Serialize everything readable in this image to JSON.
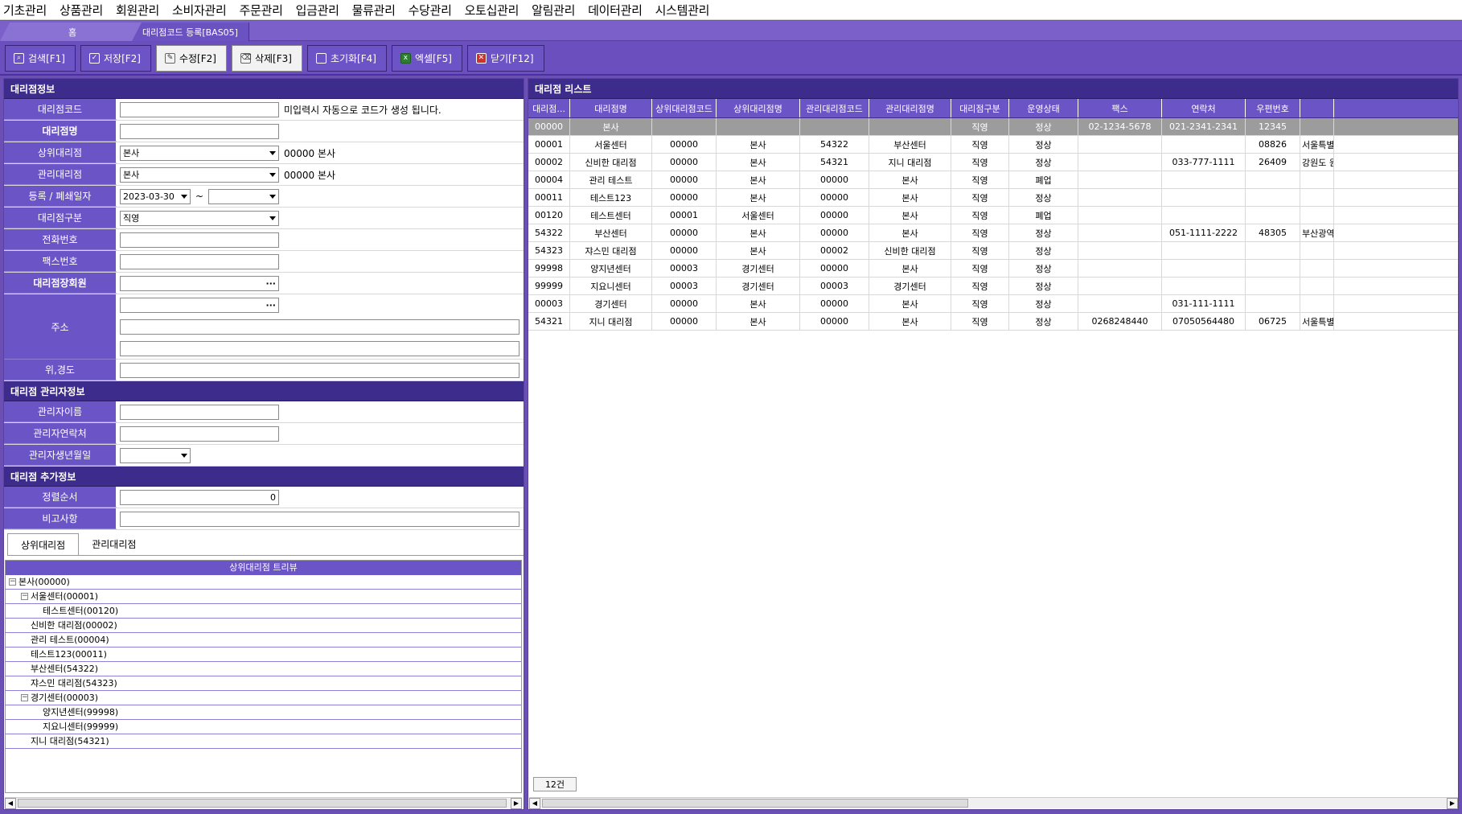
{
  "menu": [
    "기초관리",
    "상품관리",
    "회원관리",
    "소비자관리",
    "주문관리",
    "입금관리",
    "물류관리",
    "수당관리",
    "오토십관리",
    "알림관리",
    "데이터관리",
    "시스템관리"
  ],
  "tabs": {
    "home": "홈",
    "current": "대리점코드 등록[BAS05]"
  },
  "toolbar": {
    "search": "검색[F1]",
    "save": "저장[F2]",
    "edit": "수정[F2]",
    "delete": "삭제[F3]",
    "reset": "초기화[F4]",
    "excel": "엑셀[F5]",
    "close": "닫기[F12]"
  },
  "left": {
    "section_info": "대리점정보",
    "code_label": "대리점코드",
    "code_hint": "미입력시 자동으로 코드가 생성 됩니다.",
    "name_label": "대리점명",
    "parent_label": "상위대리점",
    "parent_select": "본사",
    "parent_text": "00000 본사",
    "manage_label": "관리대리점",
    "manage_select": "본사",
    "manage_text": "00000 본사",
    "date_label": "등록 / 폐쇄일자",
    "date_from": "2023-03-30",
    "date_sep": "~",
    "type_label": "대리점구분",
    "type_select": "직영",
    "phone_label": "전화번호",
    "fax_label": "팩스번호",
    "owner_label": "대리점장회원",
    "owner_dots": "···",
    "address_label": "주소",
    "address_dots": "···",
    "latlng_label": "위,경도",
    "section_manager": "대리점 관리자정보",
    "mgr_name_label": "관리자이름",
    "mgr_phone_label": "관리자연락처",
    "mgr_birth_label": "관리자생년월일",
    "section_extra": "대리점 추가정보",
    "order_label": "정렬순서",
    "order_value": "0",
    "note_label": "비고사항",
    "tree_tab_parent": "상위대리점",
    "tree_tab_manage": "관리대리점",
    "tree_title": "상위대리점 트리뷰",
    "tree": [
      {
        "label": "본사(00000)",
        "box": "⊟"
      },
      {
        "label": "서울센터(00001)",
        "box": "⊟"
      },
      {
        "label": "테스트센터(00120)",
        "box": ""
      },
      {
        "label": "신비한 대리점(00002)",
        "box": ""
      },
      {
        "label": "관리 테스트(00004)",
        "box": ""
      },
      {
        "label": "테스트123(00011)",
        "box": ""
      },
      {
        "label": "부산센터(54322)",
        "box": ""
      },
      {
        "label": "쟈스민 대리점(54323)",
        "box": ""
      },
      {
        "label": "경기센터(00003)",
        "box": "⊟"
      },
      {
        "label": "양지년센터(99998)",
        "box": ""
      },
      {
        "label": "지요니센터(99999)",
        "box": ""
      },
      {
        "label": "지니 대리점(54321)",
        "box": ""
      }
    ]
  },
  "right": {
    "title": "대리점 리스트",
    "columns": [
      "대리점...",
      "대리점명",
      "상위대리점코드",
      "상위대리점명",
      "관리대리점코드",
      "관리대리점명",
      "대리점구분",
      "운영상태",
      "팩스",
      "연락처",
      "우편번호",
      ""
    ],
    "rows": [
      [
        "00000",
        "본사",
        "",
        "",
        "",
        "",
        "직영",
        "정상",
        "02-1234-5678",
        "021-2341-2341",
        "12345",
        ""
      ],
      [
        "00001",
        "서울센터",
        "00000",
        "본사",
        "54322",
        "부산센터",
        "직영",
        "정상",
        "",
        "",
        "08826",
        "서울특별"
      ],
      [
        "00002",
        "신비한 대리점",
        "00000",
        "본사",
        "54321",
        "지니 대리점",
        "직영",
        "정상",
        "",
        "033-777-1111",
        "26409",
        "강원도 원"
      ],
      [
        "00004",
        "관리 테스트",
        "00000",
        "본사",
        "00000",
        "본사",
        "직영",
        "폐업",
        "",
        "",
        "",
        ""
      ],
      [
        "00011",
        "테스트123",
        "00000",
        "본사",
        "00000",
        "본사",
        "직영",
        "정상",
        "",
        "",
        "",
        ""
      ],
      [
        "00120",
        "테스트센터",
        "00001",
        "서울센터",
        "00000",
        "본사",
        "직영",
        "폐업",
        "",
        "",
        "",
        ""
      ],
      [
        "54322",
        "부산센터",
        "00000",
        "본사",
        "00000",
        "본사",
        "직영",
        "정상",
        "",
        "051-1111-2222",
        "48305",
        "부산광역"
      ],
      [
        "54323",
        "쟈스민 대리점",
        "00000",
        "본사",
        "00002",
        "신비한 대리점",
        "직영",
        "정상",
        "",
        "",
        "",
        ""
      ],
      [
        "99998",
        "양지년센터",
        "00003",
        "경기센터",
        "00000",
        "본사",
        "직영",
        "정상",
        "",
        "",
        "",
        ""
      ],
      [
        "99999",
        "지요니센터",
        "00003",
        "경기센터",
        "00003",
        "경기센터",
        "직영",
        "정상",
        "",
        "",
        "",
        ""
      ],
      [
        "00003",
        "경기센터",
        "00000",
        "본사",
        "00000",
        "본사",
        "직영",
        "정상",
        "",
        "031-111-1111",
        "",
        ""
      ],
      [
        "54321",
        "지니 대리점",
        "00000",
        "본사",
        "00000",
        "본사",
        "직영",
        "정상",
        "0268248440",
        "07050564480",
        "06725",
        "서울특별"
      ]
    ],
    "count": "12건"
  }
}
